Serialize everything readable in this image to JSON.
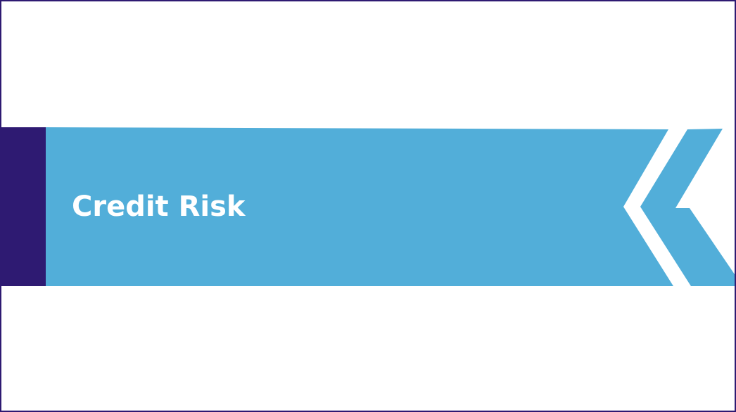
{
  "slide": {
    "title": "Credit Risk"
  },
  "colors": {
    "banner": "#52aed9",
    "accent": "#2e1a72",
    "border": "#2e1a72",
    "title_text": "#ffffff",
    "background": "#ffffff"
  }
}
